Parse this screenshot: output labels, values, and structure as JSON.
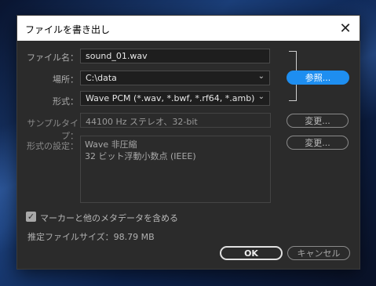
{
  "dialog": {
    "title": "ファイルを書き出し",
    "close_glyph": "✕"
  },
  "form": {
    "filename_label": "ファイル名：",
    "filename_value": "sound_01.wav",
    "location_label": "場所：",
    "location_value": "C:\\data",
    "format_label": "形式：",
    "format_value": "Wave PCM (*.wav, *.bwf, *.rf64, *.amb)",
    "sampletype_label": "サンプルタイプ：",
    "sampletype_value": "44100 Hz ステレオ、32-bit",
    "format_settings_label": "形式の設定：",
    "format_settings_lines": [
      "Wave 非圧縮",
      "32 ビット浮動小数点 (IEEE)"
    ],
    "browse_button": "参照...",
    "change_button_1": "変更...",
    "change_button_2": "変更...",
    "metadata_checkbox_label": "マーカーと他のメタデータを含める",
    "metadata_checked": true,
    "estimated_size": "推定ファイルサイズ：98.79 MB"
  },
  "actions": {
    "ok": "OK",
    "cancel": "キャンセル"
  },
  "icons": {
    "dropdown": "chevron-down-icon",
    "check": "checkmark-icon"
  },
  "colors": {
    "accent": "#1e8ef0",
    "dialog_bg": "#2b2b2b",
    "titlebar_bg": "#ffffff"
  }
}
